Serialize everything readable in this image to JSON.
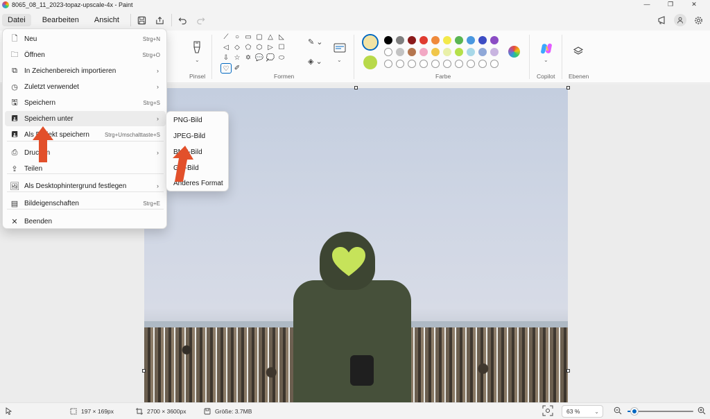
{
  "window": {
    "title": "8065_08_11_2023-topaz-upscale-4x - Paint",
    "controls": [
      "—",
      "❐",
      "✕"
    ]
  },
  "menubar": {
    "items": [
      "Datei",
      "Bearbeiten",
      "Ansicht"
    ]
  },
  "ribbon": {
    "groups": {
      "brushes": "Pinsel",
      "shapes": "Formen",
      "colors": "Farbe",
      "copilot": "Copilot",
      "layers": "Ebenen"
    },
    "shape_glyphs": [
      "⟋",
      "○",
      "▭",
      "▢",
      "△",
      "◺",
      "◁",
      "◇",
      "⬠",
      "⬡",
      "▷",
      "☐",
      "⇩",
      "☆",
      "✡",
      "💬",
      "💭",
      "⬭",
      "♡",
      "✐"
    ],
    "primary_color": "#f2e3a4",
    "secondary_color": "#b8d94a",
    "palette_row1": [
      "#000000",
      "#7f7f7f",
      "#8b1a1a",
      "#e03c31",
      "#ef8a3c",
      "#f3e94a",
      "#5ab552",
      "#4a98e0",
      "#3d4dc4",
      "#8b4cc4"
    ],
    "palette_row2": [
      "#ffffff",
      "#c3c3c3",
      "#b5764f",
      "#f2a8c4",
      "#f0c64a",
      "#e9f0a8",
      "#b5e04a",
      "#a8d8e8",
      "#8fa8d8",
      "#c8b4e0"
    ]
  },
  "file_menu": {
    "items": [
      {
        "label": "Neu",
        "shortcut": "Strg+N",
        "icon": "new-file-icon",
        "glyph": "🗋"
      },
      {
        "label": "Öffnen",
        "shortcut": "Strg+O",
        "icon": "folder-icon",
        "glyph": "🗀"
      },
      {
        "label": "In Zeichenbereich importieren",
        "shortcut": "›",
        "icon": "import-icon",
        "glyph": "⧉"
      },
      {
        "label": "Zuletzt verwendet",
        "shortcut": "›",
        "icon": "clock-icon",
        "glyph": "◷"
      },
      {
        "label": "Speichern",
        "shortcut": "Strg+S",
        "icon": "save-icon",
        "glyph": "🖫"
      },
      {
        "label": "Speichern unter",
        "shortcut": "›",
        "icon": "save-as-icon",
        "glyph": "🖪"
      },
      {
        "label": "Als Projekt speichern",
        "shortcut": "Strg+Umschalttaste+S",
        "icon": "project-save-icon",
        "glyph": "🖪"
      },
      {
        "label": "Drucken",
        "shortcut": "›",
        "icon": "printer-icon",
        "glyph": "⎙"
      },
      {
        "label": "Teilen",
        "shortcut": "",
        "icon": "share-icon",
        "glyph": "⇪"
      },
      {
        "label": "Als Desktophintergrund festlegen",
        "shortcut": "›",
        "icon": "desktop-icon",
        "glyph": "🖼"
      },
      {
        "label": "Bildeigenschaften",
        "shortcut": "Strg+E",
        "icon": "properties-icon",
        "glyph": "▤"
      },
      {
        "label": "Beenden",
        "shortcut": "",
        "icon": "close-icon",
        "glyph": "✕"
      }
    ]
  },
  "save_as_submenu": {
    "items": [
      "PNG-Bild",
      "JPEG-Bild",
      "BMP-Bild",
      "GIF-Bild",
      "Anderes Format"
    ]
  },
  "statusbar": {
    "selection_size": "197 × 169px",
    "canvas_size": "2700 × 3600px",
    "file_size": "Größe: 3.7MB",
    "zoom": "63 %",
    "zoom_level": 0.1
  }
}
